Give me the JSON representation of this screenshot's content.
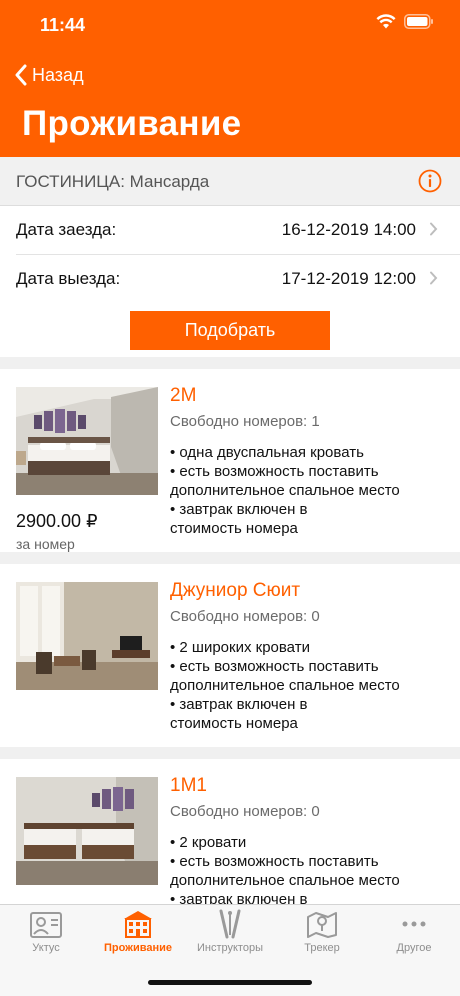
{
  "status": {
    "time": "11:44"
  },
  "nav": {
    "back_label": "Назад",
    "title": "Проживание"
  },
  "hotel": {
    "label": "ГОСТИНИЦА: Мансарда"
  },
  "dates": {
    "checkin_label": "Дата заезда:",
    "checkin_value": "16-12-2019 14:00",
    "checkout_label": "Дата  выезда:",
    "checkout_value": "17-12-2019 12:00"
  },
  "pick_button": "Подобрать",
  "rooms": [
    {
      "name": "2М",
      "availability": "Свободно номеров: 1",
      "features": [
        "• одна двуспальная кровать",
        "• есть возможность поставить",
        "дополнительное спальное место",
        "• завтрак включен в",
        "стоимость номера"
      ],
      "price": "2900.00 ₽",
      "price_unit": "за номер"
    },
    {
      "name": "Джуниор Сюит",
      "availability": "Свободно номеров: 0",
      "features": [
        "• 2 широких кровати",
        "• есть возможность поставить",
        "дополнительное спальное место",
        "• завтрак включен в",
        "стоимость номера"
      ]
    },
    {
      "name": "1М1",
      "availability": "Свободно номеров: 0",
      "features": [
        "• 2 кровати",
        "• есть возможность поставить",
        "дополнительное спальное место",
        "• завтрак включен в"
      ]
    }
  ],
  "tabs": [
    {
      "label": "Уктус",
      "icon": "id-card-icon"
    },
    {
      "label": "Проживание",
      "icon": "hotel-icon",
      "active": true
    },
    {
      "label": "Инструкторы",
      "icon": "ski-icon"
    },
    {
      "label": "Трекер",
      "icon": "map-icon"
    },
    {
      "label": "Другое",
      "icon": "more-icon"
    }
  ],
  "colors": {
    "accent": "#ff6000",
    "muted": "#8e8e8e"
  }
}
